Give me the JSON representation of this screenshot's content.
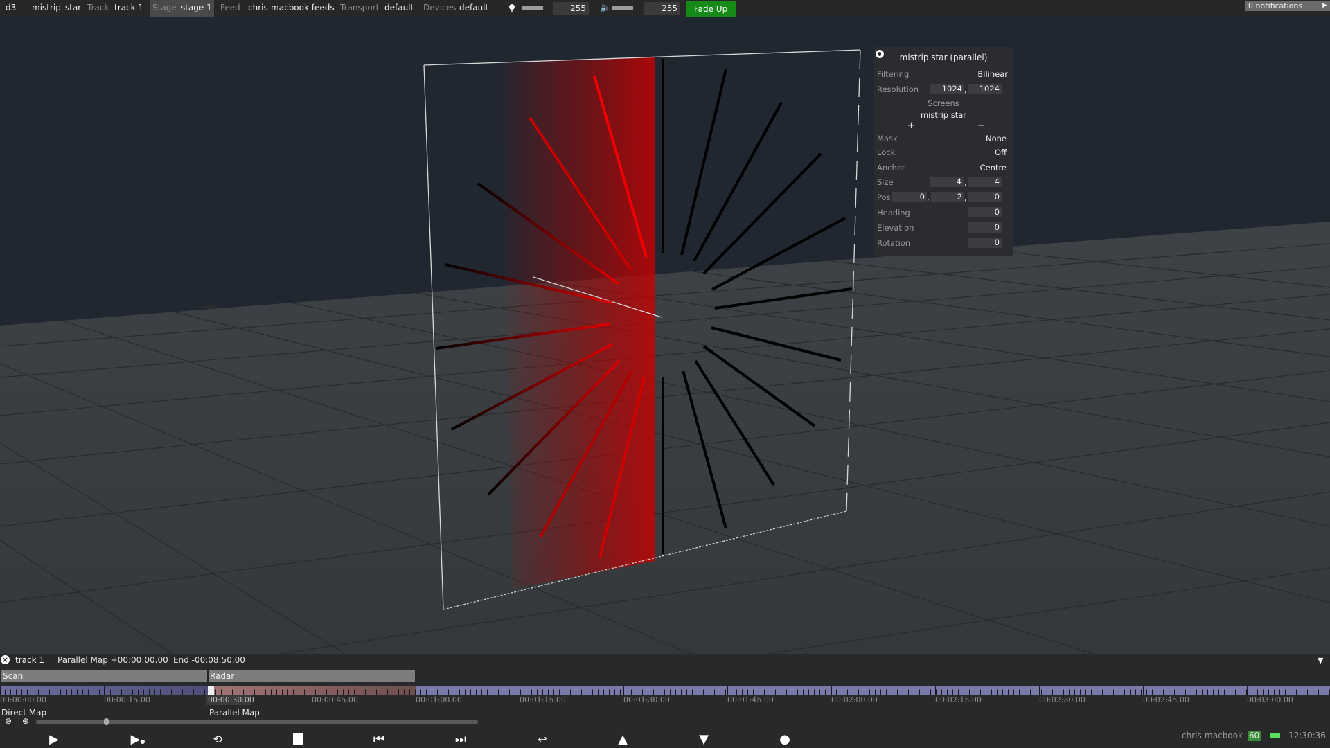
{
  "topbar": {
    "app": "d3",
    "project": "mistrip_star",
    "track_label": "Track",
    "track_value": "track 1",
    "stage_label": "Stage",
    "stage_value": "stage 1",
    "feed_label": "Feed",
    "feed_value": "chris-macbook feeds",
    "transport_label": "Transport",
    "transport_value": "default",
    "devices_label": "Devices",
    "devices_value": "default",
    "brightness_value": "255",
    "volume_value": "255",
    "fade_up_label": "Fade Up",
    "notifications": "0 notifications"
  },
  "panel": {
    "title": "mistrip star (parallel)",
    "filtering_label": "Filtering",
    "filtering_value": "Bilinear",
    "resolution_label": "Resolution",
    "resolution_x": "1024",
    "resolution_y": "1024",
    "screens_label": "Screens",
    "screens_value": "mistrip star",
    "add_label": "+",
    "remove_label": "−",
    "mask_label": "Mask",
    "mask_value": "None",
    "lock_label": "Lock",
    "lock_value": "Off",
    "anchor_label": "Anchor",
    "anchor_value": "Centre",
    "size_label": "Size",
    "size_x": "4",
    "size_y": "4",
    "pos_label": "Pos",
    "pos_x": "0",
    "pos_y": "2",
    "pos_z": "0",
    "heading_label": "Heading",
    "heading_value": "0",
    "elevation_label": "Elevation",
    "elevation_value": "0",
    "rotation_label": "Rotation",
    "rotation_value": "0"
  },
  "timeline": {
    "track_name": "track 1",
    "mapping_info": "Parallel Map +00:00:00.00",
    "end_info": "End -00:08:50.00",
    "sections": [
      {
        "label": "Scan"
      },
      {
        "label": "Radar"
      }
    ],
    "time_labels": [
      "00:00:00.00",
      "00:00:15.00",
      "00:00:30.00",
      "00:00:45.00",
      "00:01:00.00",
      "00:01:15.00",
      "00:01:30.00",
      "00:01:45.00",
      "00:02:00.00",
      "00:02:15.00",
      "00:02:30.00",
      "00:02:45.00",
      "00:03:00.00"
    ],
    "mapping_labels": [
      "Direct Map",
      "Parallel Map"
    ],
    "playhead_time": "00:00:30.00"
  },
  "colors": {
    "fade_up": "#158a16",
    "scan_section": "#7a7aa8",
    "radar_section": "#9a6a6a",
    "fps_badge": "#3a8a3a"
  },
  "status": {
    "machine": "chris-macbook",
    "fps": "60",
    "time": "12:30:36"
  }
}
